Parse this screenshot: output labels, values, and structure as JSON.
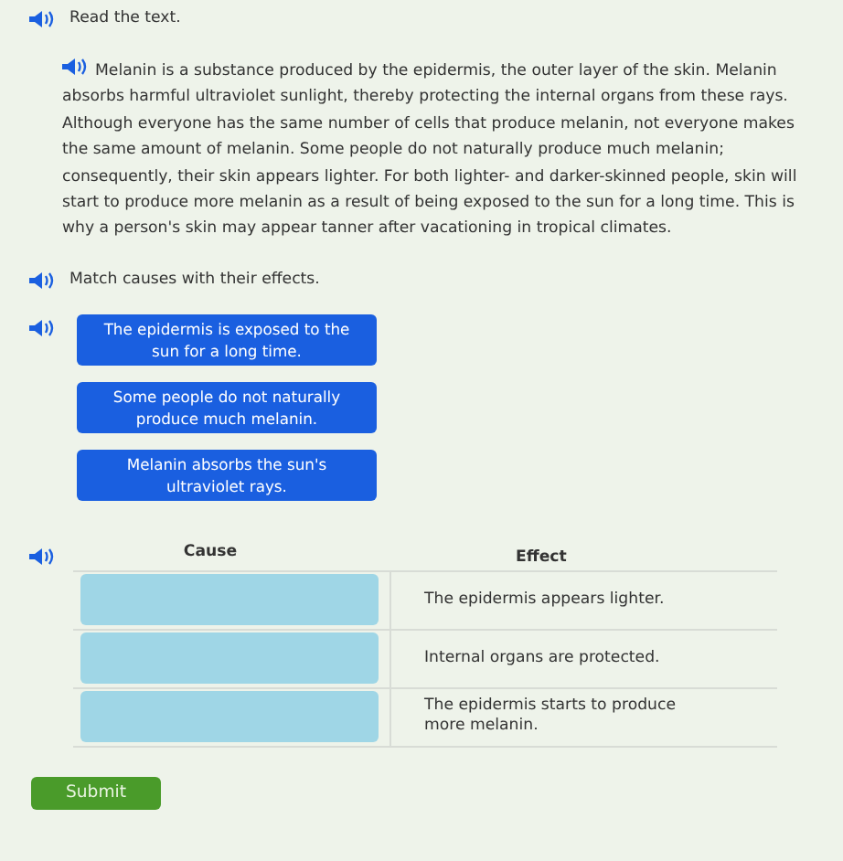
{
  "instruction": "Read the text.",
  "passage": "Melanin is a substance produced by the epidermis, the outer layer of the skin. Melanin absorbs harmful ultraviolet sunlight, thereby protecting the internal organs from these rays. Although everyone has the same number of cells that produce melanin, not everyone makes the same amount of melanin. Some people do not naturally produce much melanin; consequently, their skin appears lighter. For both lighter- and darker-skinned people, skin will start to produce more melanin as a result of being exposed to the sun for a long time. This is why a person's skin may appear tanner after vacationing in tropical climates.",
  "question": "Match causes with their effects.",
  "causes": [
    {
      "text": "The epidermis is exposed to the sun for a long time."
    },
    {
      "text": "Some people do not naturally produce much melanin."
    },
    {
      "text": "Melanin absorbs the sun's ultraviolet rays."
    }
  ],
  "table": {
    "columns": [
      "Cause",
      "Effect"
    ],
    "rows": [
      {
        "effect": "The epidermis appears lighter."
      },
      {
        "effect": "Internal organs are protected."
      },
      {
        "effect": "The epidermis starts to produce more melanin."
      }
    ]
  },
  "submit": "Submit"
}
